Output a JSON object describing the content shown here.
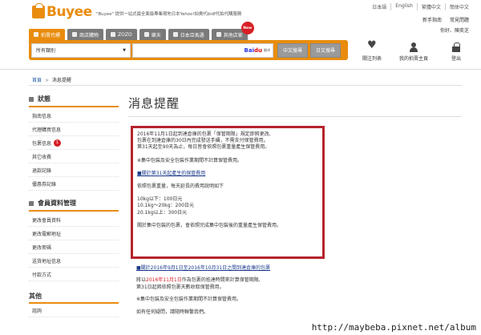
{
  "header": {
    "logo_text": "Buyee",
    "tagline": "\"Buyee\" 提供一站式最全面最專業現地日本Yahoo!拍賣代bidf代拍代購服務",
    "lang_links": [
      "日本語",
      "English",
      "繁體中文",
      "簡体中文"
    ],
    "help_links": [
      "新手指南",
      "常見問題"
    ],
    "user_links": [
      "你好、陳奕芝"
    ],
    "tabs": [
      {
        "label": "拍賣代標"
      },
      {
        "label": "商店購物"
      },
      {
        "label": "ZOZO"
      },
      {
        "label": "樂天"
      },
      {
        "label": "日本亞馬遜"
      },
      {
        "label": "其他店家"
      }
    ],
    "new_badge": "New",
    "category_select": "所有類別",
    "search_placeholder": "",
    "baidu_brand_1": "Bai",
    "baidu_brand_2": "du",
    "baidu_small": "翻译",
    "btn_cn_search": "中文搜尋",
    "btn_jp_search": "日文搜尋",
    "icon_nav": [
      {
        "label": "關注列表",
        "icon": "heart-icon"
      },
      {
        "label": "我的拍賣主頁",
        "icon": "user-icon"
      },
      {
        "label": "登出",
        "icon": "lock-icon"
      }
    ]
  },
  "breadcrumb": {
    "home": "首頁",
    "sep": ">",
    "current": "消息提醒"
  },
  "sidebar": {
    "status_head": "狀態",
    "status_items": [
      {
        "label": "指南信息"
      },
      {
        "label": "代理購買信息"
      },
      {
        "label": "包裹信息",
        "badge": "1"
      },
      {
        "label": "其它收費"
      },
      {
        "label": "退款記錄"
      },
      {
        "label": "優惠券記錄"
      }
    ],
    "member_head": "會員資料管理",
    "member_items": [
      {
        "label": "更改會員資料"
      },
      {
        "label": "更改電郵地址"
      },
      {
        "label": "更改密碼"
      },
      {
        "label": "送貨地址信息"
      },
      {
        "label": "付款方式"
      }
    ],
    "other_head": "其他",
    "other_items": [
      {
        "label": "諮詢"
      }
    ]
  },
  "main": {
    "page_title": "消息提醒",
    "notice": {
      "l1": "2016年11月1日起到達倉庫的包裹「保管期限」規定即將更改,",
      "l2": "包裹在到達倉庫的30日內完成發送手續，不需支付保管費用。",
      "l3": "第31天起至90天為止，每日皆會依照包裹重量產生保管費用。",
      "l4": "※集中包裝及安全包裝作業期間不計算保管費用。",
      "l5": "■關於第31天起產生的保管費用",
      "l6": "依照包裹重量，每天延長的費用說明如下",
      "l7": "10kg以下：100日元",
      "l8": "10.1kg～20kg：200日元",
      "l9": "20.1kg以上：300日元",
      "l10": "關於集中包裝的包裹，會依照完成集中包裝後的重量產生保管費用。"
    },
    "after": {
      "l1": "■關於2016年9月1日至2016年10月31日之間到達倉庫的包裹",
      "l2a": "將以",
      "l2b": "2016年11月1日",
      "l2c": "作為包裹的抵達時間來計算保管期限,",
      "l3": "第31日起將依照包裹天數收取保管費用。",
      "l4": "※集中包裝及安全包裝作業期間不計算保管費用。",
      "l5": "如有任何疑問，請隨時聯繫我們。"
    }
  },
  "watermark": "http://maybeba.pixnet.net/album",
  "colors": {
    "brand_orange": "#e98c0e",
    "notice_border": "#b5242d",
    "badge_red": "#d61f26",
    "link_blue": "#1a55a8"
  }
}
